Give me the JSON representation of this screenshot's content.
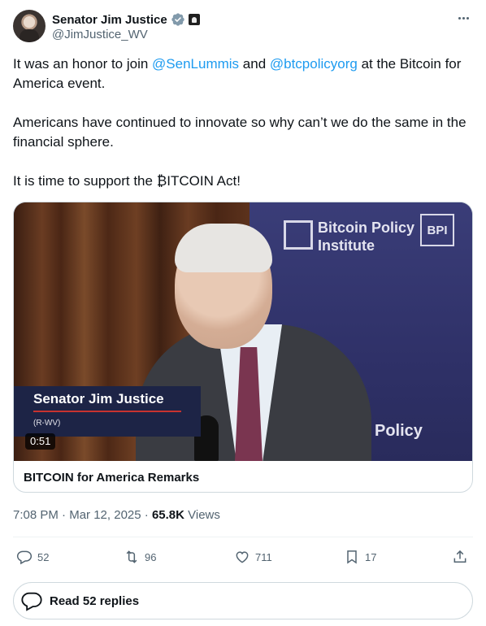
{
  "author": {
    "display_name": "Senator Jim Justice",
    "handle": "@JimJustice_WV",
    "verified_icon": "verified-badge-icon",
    "affiliation_icon": "government-affiliation-icon"
  },
  "tweet": {
    "line1_a": "It was an honor to join ",
    "mention1": "@SenLummis",
    "line1_b": " and ",
    "mention2": "@btcpolicyorg",
    "line1_c": " at the Bitcoin for America event.",
    "paragraph2": "Americans have continued to innovate so why can’t we do the same in the financial sphere.",
    "paragraph3": "It is time to support the ₿ITCOIN Act!"
  },
  "media": {
    "banner_org": "Bitcoin Policy",
    "banner_org_line2": "Institute",
    "banner_badge": "BPI",
    "banner_partial": "Policy",
    "lower_third_name": "Senator Jim Justice",
    "lower_third_sub": "(R-WV)",
    "duration": "0:51",
    "card_title": "BITCOIN for America Remarks"
  },
  "meta": {
    "time": "7:08 PM",
    "separator": " · ",
    "date": "Mar 12, 2025",
    "separator2": " · ",
    "views_count": "65.8K",
    "views_label": " Views"
  },
  "actions": {
    "replies": "52",
    "reposts": "96",
    "likes": "711",
    "bookmarks": "17"
  },
  "read_replies": "Read 52 replies",
  "colors": {
    "accent": "#1d9bf0",
    "text": "#0f1419",
    "secondary": "#536471",
    "border": "#cfd9de"
  }
}
